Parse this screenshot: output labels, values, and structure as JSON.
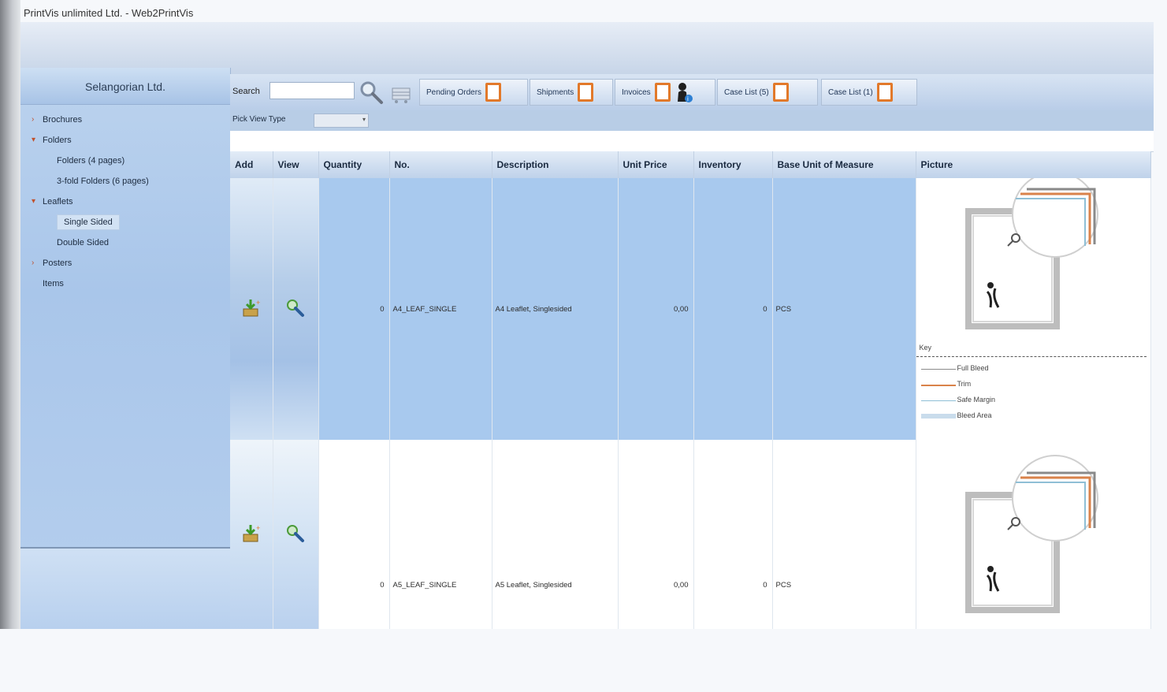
{
  "window": {
    "title": "PrintVis unlimited Ltd. - Web2PrintVis"
  },
  "sidebar": {
    "company": "Selangorian Ltd.",
    "items": [
      {
        "label": "Brochures",
        "level": 0
      },
      {
        "label": "Folders",
        "level": 0
      },
      {
        "label": "Folders (4 pages)",
        "level": 1
      },
      {
        "label": "3-fold Folders (6 pages)",
        "level": 1
      },
      {
        "label": "Leaflets",
        "level": 0
      },
      {
        "label": "Single Sided",
        "level": 1,
        "selected": true
      },
      {
        "label": "Double Sided",
        "level": 1
      },
      {
        "label": "Posters",
        "level": 0
      },
      {
        "label": "Items",
        "level": 0
      }
    ]
  },
  "toolbar": {
    "search_label": "Search",
    "search_value": "",
    "buttons": [
      {
        "label": "Pending Orders"
      },
      {
        "label": "Shipments"
      },
      {
        "label": "Invoices"
      },
      {
        "label": "Case List (5)"
      },
      {
        "label": "Case List (1)"
      }
    ]
  },
  "view_type": {
    "label": "Pick View Type",
    "value": ""
  },
  "table": {
    "columns": [
      "Add",
      "View",
      "Quantity",
      "No.",
      "Description",
      "Unit Price",
      "Inventory",
      "Base Unit of Measure",
      "Picture"
    ],
    "rows": [
      {
        "quantity": "0",
        "no": "A4_LEAF_SINGLE",
        "description": "A4 Leaflet, Singlesided",
        "unit_price": "0,00",
        "inventory": "0",
        "uom": "PCS"
      },
      {
        "quantity": "0",
        "no": "A5_LEAF_SINGLE",
        "description": "A5 Leaflet, Singlesided",
        "unit_price": "0,00",
        "inventory": "0",
        "uom": "PCS"
      }
    ]
  },
  "picture_key": {
    "title": "Key",
    "items": [
      {
        "label": "Full Bleed",
        "color": "#8a8a8a"
      },
      {
        "label": "Trim",
        "color": "#d9824a"
      },
      {
        "label": "Safe Margin",
        "color": "#8fbfd6"
      },
      {
        "label": "Bleed Area",
        "color": "#c9dcec"
      }
    ]
  },
  "colors": {
    "accent": "#e2792a",
    "selected_row": "#a8c9ee",
    "sidebar": "#aec9ea"
  }
}
